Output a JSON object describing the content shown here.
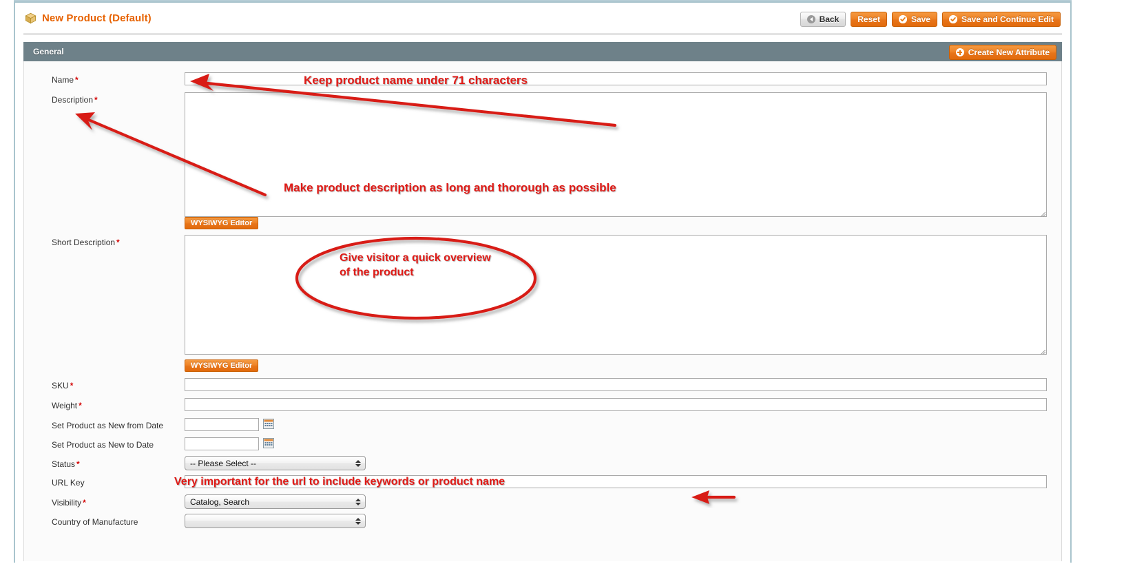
{
  "page": {
    "title": "New Product (Default)",
    "icon": "cube-icon",
    "accent_orange": "#e76200",
    "section_header_bg": "#6e8189",
    "annotation_color": "#e01b17"
  },
  "toolbar": {
    "back_label": "Back",
    "reset_label": "Reset",
    "save_label": "Save",
    "save_continue_label": "Save and Continue Edit"
  },
  "section": {
    "title": "General",
    "create_attribute_label": "Create New Attribute"
  },
  "fields": {
    "name": {
      "label": "Name",
      "required": "*",
      "value": ""
    },
    "description": {
      "label": "Description",
      "required": "*",
      "value": "",
      "editor_button": "WYSIWYG Editor"
    },
    "short_description": {
      "label": "Short Description",
      "required": "*",
      "value": "",
      "editor_button": "WYSIWYG Editor"
    },
    "sku": {
      "label": "SKU",
      "required": "*",
      "value": ""
    },
    "weight": {
      "label": "Weight",
      "required": "*",
      "value": ""
    },
    "new_from_date": {
      "label": "Set Product as New from Date",
      "required": "",
      "value": "",
      "picker_icon": "calendar-icon"
    },
    "new_to_date": {
      "label": "Set Product as New to Date",
      "required": "",
      "value": "",
      "picker_icon": "calendar-icon"
    },
    "status": {
      "label": "Status",
      "required": "*",
      "value": "-- Please Select --"
    },
    "url_key": {
      "label": "URL Key",
      "required": "",
      "value": ""
    },
    "visibility": {
      "label": "Visibility",
      "required": "*",
      "value": "Catalog, Search"
    },
    "country_of_manufacture": {
      "label": "Country of Manufacture",
      "required": "",
      "value": ""
    }
  },
  "annotations": {
    "name_note": "Keep product name under 71 characters",
    "description_note": "Make product description as long and thorough as possible",
    "short_description_note_line1": "Give visitor a quick overview",
    "short_description_note_line2": "of the product",
    "url_key_note": "Very important for the url to include keywords or product name"
  }
}
